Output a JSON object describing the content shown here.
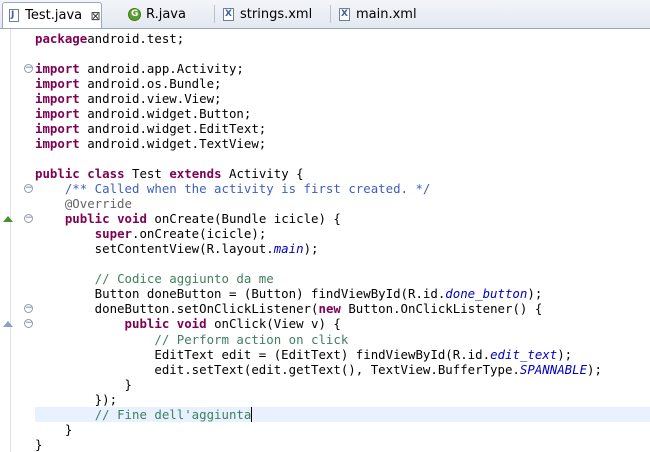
{
  "tabs": [
    {
      "label": "Test.java",
      "icon": "java-file-icon",
      "active": true,
      "closable": true
    },
    {
      "label": "R.java",
      "icon": "java-class-icon",
      "active": false
    },
    {
      "label": "strings.xml",
      "icon": "xml-file-icon",
      "active": false
    },
    {
      "label": "main.xml",
      "icon": "xml-file-icon",
      "active": false
    }
  ],
  "code_lines": [
    [
      [
        "kw",
        "package"
      ],
      [
        "",
        "android.test;"
      ]
    ],
    [],
    [
      [
        "kw",
        "import"
      ],
      [
        "",
        " android.app.Activity;"
      ]
    ],
    [
      [
        "kw",
        "import"
      ],
      [
        "",
        " android.os.Bundle;"
      ]
    ],
    [
      [
        "kw",
        "import"
      ],
      [
        "",
        " android.view.View;"
      ]
    ],
    [
      [
        "kw",
        "import"
      ],
      [
        "",
        " android.widget.Button;"
      ]
    ],
    [
      [
        "kw",
        "import"
      ],
      [
        "",
        " android.widget.EditText;"
      ]
    ],
    [
      [
        "kw",
        "import"
      ],
      [
        "",
        " android.widget.TextView;"
      ]
    ],
    [],
    [
      [
        "kw",
        "public"
      ],
      [
        "",
        " "
      ],
      [
        "kw",
        "class"
      ],
      [
        "",
        " Test "
      ],
      [
        "kw",
        "extends"
      ],
      [
        "",
        " Activity {"
      ]
    ],
    [
      [
        "",
        "    "
      ],
      [
        "cm",
        "/** Called when the activity is first created. */"
      ]
    ],
    [
      [
        "",
        "    "
      ],
      [
        "an",
        "@Override"
      ]
    ],
    [
      [
        "",
        "    "
      ],
      [
        "kw",
        "public"
      ],
      [
        "",
        " "
      ],
      [
        "kw",
        "void"
      ],
      [
        "",
        " onCreate(Bundle icicle) {"
      ]
    ],
    [
      [
        "",
        "        "
      ],
      [
        "kw",
        "super"
      ],
      [
        "",
        ".onCreate(icicle);"
      ]
    ],
    [
      [
        "",
        "        setContentView(R.layout."
      ],
      [
        "it",
        "main"
      ],
      [
        "",
        ");"
      ]
    ],
    [],
    [
      [
        "",
        "        "
      ],
      [
        "lc",
        "// Codice aggiunto da me"
      ]
    ],
    [
      [
        "",
        "        Button doneButton = (Button) findViewById(R.id."
      ],
      [
        "it",
        "done_button"
      ],
      [
        "",
        ");"
      ]
    ],
    [
      [
        "",
        "        doneButton.setOnClickListener("
      ],
      [
        "kw",
        "new"
      ],
      [
        "",
        " Button.OnClickListener() {"
      ]
    ],
    [
      [
        "",
        "            "
      ],
      [
        "kw",
        "public"
      ],
      [
        "",
        " "
      ],
      [
        "kw",
        "void"
      ],
      [
        "",
        " onClick(View v) {"
      ]
    ],
    [
      [
        "",
        "                "
      ],
      [
        "lc",
        "// Perform action on click"
      ]
    ],
    [
      [
        "",
        "                EditText edit = (EditText) findViewById(R.id."
      ],
      [
        "it",
        "edit_text"
      ],
      [
        "",
        ");"
      ]
    ],
    [
      [
        "",
        "                edit.setText(edit.getText(), TextView.BufferType."
      ],
      [
        "it",
        "SPANNABLE"
      ],
      [
        "",
        ");"
      ]
    ],
    [
      [
        "",
        "            }"
      ]
    ],
    [
      [
        "",
        "        });"
      ]
    ],
    [
      [
        "",
        "        "
      ],
      [
        "lc",
        "// Fine dell'aggiunta"
      ]
    ],
    [
      [
        "",
        "    }"
      ]
    ],
    [
      [
        "",
        "}"
      ]
    ]
  ],
  "current_line_index": 25,
  "fold_markers": [
    {
      "line": 2,
      "symbol": "⊖"
    },
    {
      "line": 10,
      "symbol": "⊖"
    },
    {
      "line": 12,
      "symbol": "⊖"
    },
    {
      "line": 18,
      "symbol": "⊖"
    },
    {
      "line": 19,
      "symbol": "⊖"
    }
  ],
  "override_markers": [
    {
      "line": 12,
      "kind": "overrides"
    },
    {
      "line": 19,
      "kind": "implements"
    }
  ],
  "colors": {
    "keyword": "#7f0055",
    "javadoc": "#3f5fbf",
    "line_comment": "#3f7f5f",
    "annotation": "#646464",
    "static_field": "#0000c0",
    "current_line": "#e8f2fe"
  }
}
